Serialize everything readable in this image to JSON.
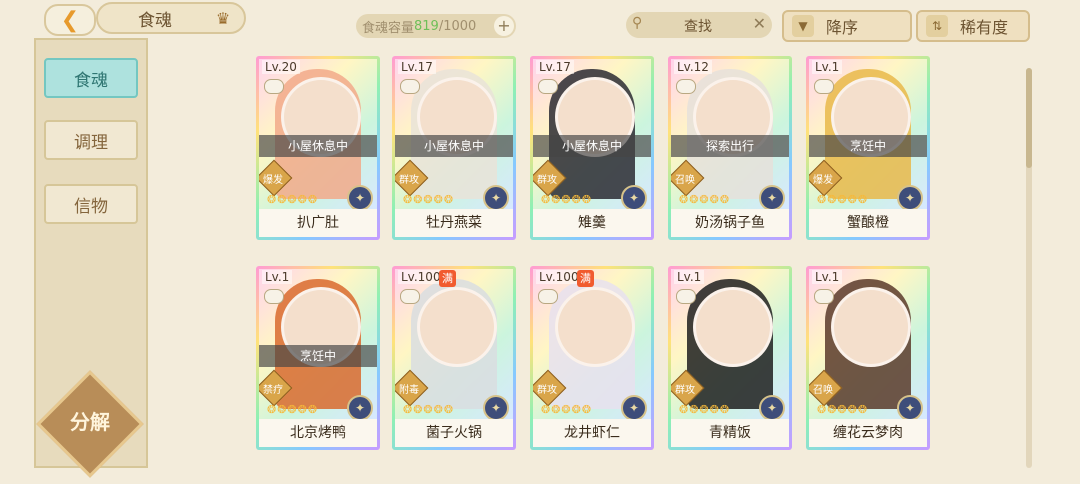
{
  "header": {
    "back_icon": "chevron-left-icon",
    "title": "食魂",
    "capacity_label": "食魂容量",
    "capacity_current": "819",
    "capacity_total": "/1000",
    "search_placeholder": "查找",
    "sort_order": "降序",
    "sort_by": "稀有度"
  },
  "sidebar": {
    "items": [
      {
        "label": "食魂",
        "active": true
      },
      {
        "label": "调理",
        "active": false
      },
      {
        "label": "信物",
        "active": false
      }
    ],
    "decompose_label": "分解"
  },
  "cards": [
    {
      "level": "Lv.20",
      "status": "小屋休息中",
      "type": "爆发",
      "name": "扒广肚",
      "stars": 5,
      "max": false
    },
    {
      "level": "Lv.17",
      "status": "小屋休息中",
      "type": "群攻",
      "name": "牡丹燕菜",
      "stars": 5,
      "max": false
    },
    {
      "level": "Lv.17",
      "status": "小屋休息中",
      "type": "群攻",
      "name": "雉羹",
      "stars": 5,
      "max": false
    },
    {
      "level": "Lv.12",
      "status": "探索出行",
      "type": "召唤",
      "name": "奶汤锅子鱼",
      "stars": 5,
      "max": false
    },
    {
      "level": "Lv.1",
      "status": "烹饪中",
      "type": "爆发",
      "name": "蟹酿橙",
      "stars": 5,
      "max": false
    },
    {
      "level": "Lv.1",
      "status": "烹饪中",
      "type": "禁疗",
      "name": "北京烤鸭",
      "stars": 5,
      "max": false
    },
    {
      "level": "Lv.100",
      "status": "",
      "type": "附毒",
      "name": "菌子火锅",
      "stars": 5,
      "max": true,
      "max_label": "满"
    },
    {
      "level": "Lv.100",
      "status": "",
      "type": "群攻",
      "name": "龙井虾仁",
      "stars": 5,
      "max": true,
      "max_label": "满"
    },
    {
      "level": "Lv.1",
      "status": "",
      "type": "群攻",
      "name": "青精饭",
      "stars": 5,
      "max": false
    },
    {
      "level": "Lv.1",
      "status": "",
      "type": "召唤",
      "name": "缠花云梦肉",
      "stars": 5,
      "max": false
    }
  ],
  "colors": {
    "background": "#f3ecdb",
    "active_tab": "#aee2de",
    "capacity_current": "#6fbf58",
    "max_badge": "#f15b2f"
  }
}
